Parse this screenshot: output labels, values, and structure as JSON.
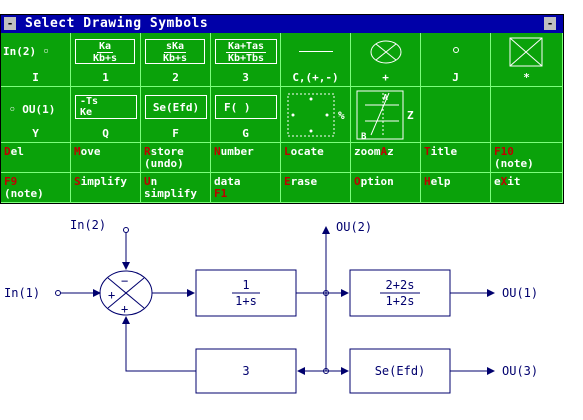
{
  "window": {
    "title": "Select Drawing Symbols",
    "min_button": "-",
    "close_button": "-"
  },
  "palette": {
    "row1": [
      {
        "icon": "In(2) ◦",
        "label": "I"
      },
      {
        "num": "Ka",
        "den": "Kb+s",
        "label": "1"
      },
      {
        "num": "sKa",
        "den": "Kb+s",
        "label": "2"
      },
      {
        "num": "Ka+Tas",
        "den": "Kb+Tbs",
        "label": "3"
      },
      {
        "label": "C,(+,-)"
      },
      {
        "label": "+"
      },
      {
        "label": "J"
      },
      {
        "label": "*"
      }
    ],
    "row2": [
      {
        "icon": "◦ OU(1)",
        "label": "Y"
      },
      {
        "num": "-Ts",
        "den": "Ke",
        "label": "Q"
      },
      {
        "icon": "Se(Efd)",
        "label": "F"
      },
      {
        "icon": "F(  )",
        "label": "G"
      },
      {
        "label": "%"
      },
      {
        "label": "Z"
      }
    ],
    "menu": [
      {
        "hot": "D",
        "rest": "el"
      },
      {
        "hot": "M",
        "rest": "ove"
      },
      {
        "hot": "R",
        "rest": "store\n(undo)"
      },
      {
        "hot": "N",
        "rest": "umber"
      },
      {
        "hot": "L",
        "rest": "ocate"
      },
      {
        "pre": "zoom",
        "hot": "A",
        "rest": "z"
      },
      {
        "hot": "T",
        "rest": "itle"
      },
      {
        "hot": "F10",
        "rest": "\n(note)"
      },
      {
        "hot": "F9",
        "rest": "\n(note)"
      },
      {
        "hot": "S",
        "rest": "implify"
      },
      {
        "hot": "U",
        "rest": "n\nsimplify"
      },
      {
        "pre": "data\n",
        "hot": "F1",
        "rest": ""
      },
      {
        "hot": "E",
        "rest": "rase"
      },
      {
        "hot": "O",
        "rest": "ption"
      },
      {
        "hot": "H",
        "rest": "elp"
      },
      {
        "pre": "e",
        "hot": "X",
        "rest": "it"
      }
    ]
  },
  "diagram": {
    "in1": "In(1)",
    "in2": "In(2)",
    "ou1": "OU(1)",
    "ou2": "OU(2)",
    "ou3": "OU(3)",
    "block1_num": "1",
    "block1_den": "1+s",
    "block2_num": "2+2s",
    "block2_den": "1+2s",
    "block3": "3",
    "block4": "Se(Efd)",
    "sum_top": "−",
    "sum_left": "+",
    "sum_bottom": "+"
  },
  "colors": {
    "palette_bg": "#0aa20a",
    "titlebar": "#0000a8",
    "hotkey": "#c00000",
    "diagram_line": "#00006e"
  }
}
